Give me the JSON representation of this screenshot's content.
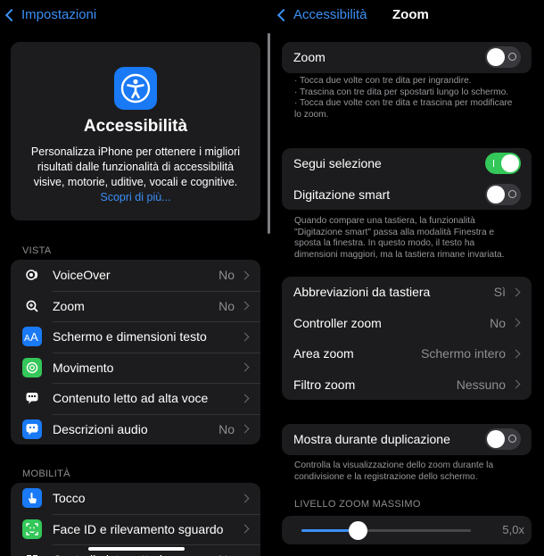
{
  "left": {
    "back_label": "Impostazioni",
    "hero": {
      "title": "Accessibilità",
      "description": "Personalizza iPhone per ottenere i migliori risultati dalle funzionalità di accessibilità visive, motorie, uditive, vocali e cognitive.",
      "link": "Scopri di più..."
    },
    "vista_label": "VISTA",
    "vista_items": [
      {
        "label": "VoiceOver",
        "value": "No",
        "icon": "voiceover-icon",
        "color": "#1c1c1e"
      },
      {
        "label": "Zoom",
        "value": "No",
        "icon": "zoom-icon",
        "color": "#1c1c1e"
      },
      {
        "label": "Schermo e dimensioni testo",
        "value": "",
        "icon": "text-size-icon",
        "color": "#1a7af5"
      },
      {
        "label": "Movimento",
        "value": "",
        "icon": "motion-icon",
        "color": "#34c759"
      },
      {
        "label": "Contenuto letto ad alta voce",
        "value": "",
        "icon": "spoken-content-icon",
        "color": "#1c1c1e"
      },
      {
        "label": "Descrizioni audio",
        "value": "No",
        "icon": "audio-description-icon",
        "color": "#1a7af5"
      }
    ],
    "mobilita_label": "MOBILITÀ",
    "mobilita_items": [
      {
        "label": "Tocco",
        "value": "",
        "icon": "touch-icon",
        "color": "#1a7af5"
      },
      {
        "label": "Face ID e rilevamento sguardo",
        "value": "",
        "icon": "faceid-icon",
        "color": "#34c759"
      },
      {
        "label": "Controllo interruttori",
        "value": "No",
        "icon": "switch-control-icon",
        "color": "#1c1c1e"
      }
    ]
  },
  "right": {
    "back_label": "Accessibilità",
    "title": "Zoom",
    "zoom_toggle_label": "Zoom",
    "zoom_toggle_on": false,
    "zoom_notes": [
      "Tocca due volte con tre dita per ingrandire.",
      "Trascina con tre dita per spostarti lungo lo schermo.",
      "Tocca due volte con tre dita e trascina per modificare lo zoom."
    ],
    "follow_focus_label": "Segui selezione",
    "follow_focus_on": true,
    "smart_typing_label": "Digitazione smart",
    "smart_typing_on": false,
    "smart_typing_note": "Quando compare una tastiera, la funzionalità \"Digitazione smart\" passa alla modalità Finestra e sposta la finestra. In questo modo, il testo ha dimensioni maggiori, ma la tastiera rimane invariata.",
    "options": [
      {
        "label": "Abbreviazioni da tastiera",
        "value": "Sì"
      },
      {
        "label": "Controller zoom",
        "value": "No"
      },
      {
        "label": "Area zoom",
        "value": "Schermo intero"
      },
      {
        "label": "Filtro zoom",
        "value": "Nessuno"
      }
    ],
    "mirror_label": "Mostra durante duplicazione",
    "mirror_on": false,
    "mirror_note": "Controlla la visualizzazione dello zoom durante la condivisione e la registrazione dello schermo.",
    "max_zoom_label": "LIVELLO ZOOM MASSIMO",
    "max_zoom_value": "5,0x",
    "max_zoom_fraction": 0.33
  }
}
